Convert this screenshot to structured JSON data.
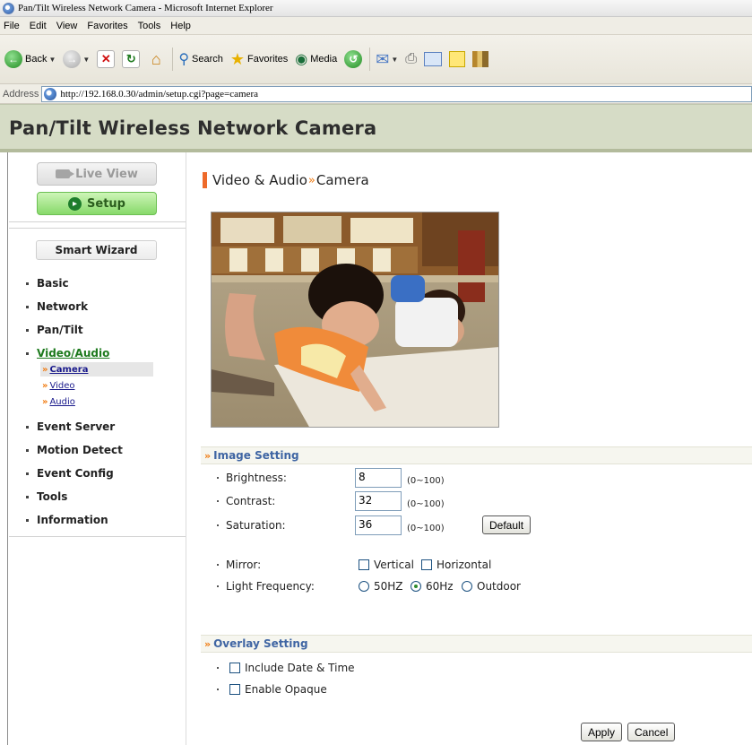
{
  "window": {
    "title": "Pan/Tilt Wireless Network Camera - Microsoft Internet Explorer"
  },
  "menu": [
    "File",
    "Edit",
    "View",
    "Favorites",
    "Tools",
    "Help"
  ],
  "toolbar": {
    "back_label": "Back",
    "search_label": "Search",
    "favorites_label": "Favorites",
    "media_label": "Media"
  },
  "address": {
    "label": "Address",
    "url": "http://192.168.0.30/admin/setup.cgi?page=camera"
  },
  "header": {
    "title": "Pan/Tilt Wireless Network Camera"
  },
  "sidebar": {
    "live_view": "Live View",
    "setup": "Setup",
    "smart_wizard": "Smart Wizard",
    "items": [
      "Basic",
      "Network",
      "Pan/Tilt",
      "Video/Audio",
      "Event Server",
      "Motion Detect",
      "Event Config",
      "Tools",
      "Information"
    ],
    "active_item": "Video/Audio",
    "subitems": [
      "Camera",
      "Video",
      "Audio"
    ],
    "active_subitem": "Camera"
  },
  "main": {
    "breadcrumb": {
      "section": "Video & Audio",
      "separator": "»",
      "page": "Camera"
    },
    "image_setting": {
      "title": "Image Setting",
      "brightness": {
        "label": "Brightness:",
        "value": "8",
        "range": "(0~100)"
      },
      "contrast": {
        "label": "Contrast:",
        "value": "32",
        "range": "(0~100)"
      },
      "saturation": {
        "label": "Saturation:",
        "value": "36",
        "range": "(0~100)"
      },
      "default_button": "Default",
      "mirror": {
        "label": "Mirror:",
        "vertical": "Vertical",
        "horizontal": "Horizontal"
      },
      "light_frequency": {
        "label": "Light Frequency:",
        "options": [
          "50HZ",
          "60Hz",
          "Outdoor"
        ],
        "selected": "60Hz"
      }
    },
    "overlay_setting": {
      "title": "Overlay Setting",
      "include_date_time": "Include Date & Time",
      "enable_opaque": "Enable Opaque"
    },
    "apply_button": "Apply",
    "cancel_button": "Cancel"
  },
  "colors": {
    "header_bg": "#d6dcc6",
    "accent_orange": "#ee6a2a",
    "section_title": "#3f65a3",
    "active_link": "#1d7a1d"
  }
}
